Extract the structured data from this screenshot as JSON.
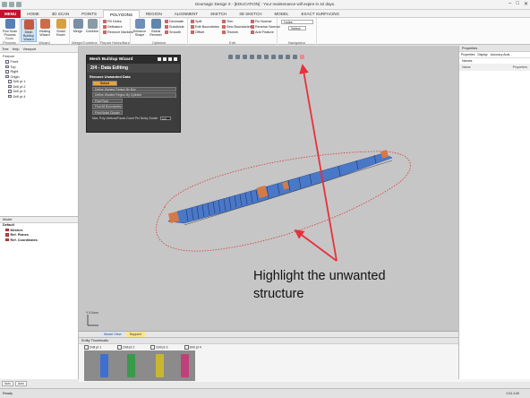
{
  "window": {
    "title": "Geomagic Design X - [EDUCATION] : Your maintenance will expire in 42 days."
  },
  "menu_tabs": [
    "MENU",
    "HOME",
    "3D SCAN",
    "POINTS",
    "POLYGONS",
    "REGION",
    "ALIGNMENT",
    "SKETCH",
    "3D SKETCH",
    "MODEL",
    "EXACT SURFACING"
  ],
  "active_tab": "POLYGONS",
  "ribbon": {
    "groups": [
      {
        "name": "Scan Process",
        "buttons": [
          "Run Scan Process"
        ]
      },
      {
        "name": "Wizard",
        "buttons": [
          "Mesh Buildup Wizard",
          "Healing Wizard",
          "Smart Brush"
        ]
      },
      {
        "name": "Merge/Combine",
        "buttons": [
          "Merge",
          "Combine"
        ]
      },
      {
        "name": "Repair Holes/Bars",
        "items": [
          "Fill Holes",
          "Defeature",
          "Remove Markers"
        ]
      },
      {
        "name": "Optimize",
        "items": [
          "Enhance Shape",
          "Global Remesh",
          "Decimate",
          "Subdivide",
          "Smooth"
        ]
      },
      {
        "name": "Edit",
        "items": [
          "Split",
          "Edit Boundaries",
          "Offset",
          "Trim",
          "Sew Boundaries",
          "Thicken",
          "Fix Normal",
          "Reverse Normal",
          "Add Feature"
        ]
      },
      {
        "name": "Navigation",
        "items": [
          "Holes",
          "Select"
        ]
      }
    ]
  },
  "left_panel": {
    "tabs": [
      "Tree",
      "Help",
      "Viewport"
    ],
    "feature_header": "Feature",
    "feature_tree": [
      "Front",
      "Top",
      "Right",
      "Origin",
      "Drill pt 1",
      "Drill pt 2",
      "Drill pt 3",
      "Drill pt 4"
    ],
    "model_header": "Model",
    "model_tree": [
      "Default",
      "Meshes",
      "Ref. Planes",
      "Ref. Coordinates"
    ]
  },
  "wizard": {
    "title": "Mesh Buildup Wizard",
    "step": "2/4 - Data Editing",
    "section": "Remove Unwanted Data",
    "buttons": [
      "Select",
      "Define Wanted Region By Box",
      "Define Wanted Region By Cylinder",
      "Find Floor",
      "Find All Boundaries",
      "Find Noisy Cluster"
    ],
    "threshold_label": "Max. Poly-Vertices/Faces Count Per Noisy Cluster",
    "threshold_value": "100"
  },
  "annotation": {
    "line1": "Highlight the unwanted",
    "line2": "structure"
  },
  "viewport": {
    "axes_label": "Y   0.0mm",
    "tabs": [
      "Model View",
      "Support"
    ],
    "active_tab": "Support"
  },
  "thumbnails": {
    "header": "Entity Thumbnails",
    "labels": [
      "Drill pt 1",
      "Drill pt 2",
      "Drill pt 3",
      "Drill pt 4"
    ],
    "colors": [
      "#3f6fcf",
      "#3a9a4a",
      "#c8b630",
      "#c0407a"
    ]
  },
  "right_panel": {
    "title": "Properties",
    "tabs": [
      "Properties",
      "Display",
      "Accuracy Anal..."
    ],
    "filter": "Names",
    "columns": [
      "Name",
      "Properties"
    ]
  },
  "statusbar": {
    "ready": "Ready",
    "toggles": [
      "Auto",
      "Auto"
    ],
    "time": "0:11:140"
  },
  "colors": {
    "menu_red": "#c8102e",
    "wizard_select": "#e8a33c",
    "annotation_arrow": "#e8303a",
    "mesh_blue": "#4a78c8",
    "mesh_orange": "#d47a48",
    "viewport_bg": "#c6c6c6"
  },
  "icons": [
    "quick-access-icons",
    "window-controls-icons",
    "tree-node-icon",
    "nav-toolbar-icons",
    "close-icon",
    "ok-icon"
  ]
}
